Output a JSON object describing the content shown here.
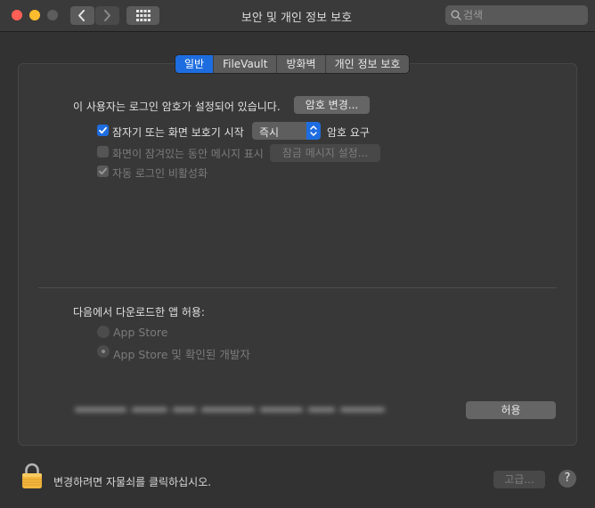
{
  "window": {
    "title": "보안 및 개인 정보 보호",
    "search_placeholder": "검색"
  },
  "tabs": [
    {
      "label": "일반",
      "active": true
    },
    {
      "label": "FileVault",
      "active": false
    },
    {
      "label": "방화벽",
      "active": false
    },
    {
      "label": "개인 정보 보호",
      "active": false
    }
  ],
  "general": {
    "password_status": "이 사용자는 로그인 암호가 설정되어 있습니다.",
    "change_password_button": "암호 변경...",
    "require_password": {
      "label": "잠자기 또는 화면 보호기 시작",
      "checked": true,
      "select_value": "즉시",
      "suffix": "암호 요구"
    },
    "show_message": {
      "label": "화면이 잠겨있는 동안 메시지 표시",
      "checked": false,
      "enabled": false,
      "button": "잠금 메시지 설정..."
    },
    "disable_auto_login": {
      "label": "자동 로그인 비활성화",
      "checked": true,
      "enabled": false
    }
  },
  "downloads": {
    "heading": "다음에서 다운로드한 앱 허용:",
    "options": [
      {
        "label": "App Store",
        "selected": false
      },
      {
        "label": "App Store 및 확인된 개발자",
        "selected": true
      }
    ],
    "allow_button": "허용"
  },
  "footer": {
    "lock_text": "변경하려면 자물쇠를 클릭하십시오.",
    "advanced_button": "고급...",
    "help_label": "?"
  },
  "colors": {
    "accent": "#1e6de0",
    "close": "#fe5f57",
    "minimize": "#febc2e"
  }
}
